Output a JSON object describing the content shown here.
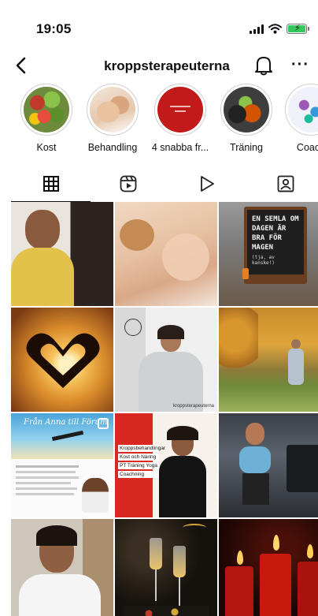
{
  "status": {
    "time": "19:05"
  },
  "header": {
    "username": "kroppsterapeuterna"
  },
  "highlights": [
    {
      "label": "Kost",
      "icon": "vegetables"
    },
    {
      "label": "Behandling",
      "icon": "massage"
    },
    {
      "label": "4 snabba fr...",
      "icon": "red-cover"
    },
    {
      "label": "Träning",
      "icon": "kettlebells"
    },
    {
      "label": "Coach",
      "icon": "coach"
    }
  ],
  "tabs": [
    {
      "name": "grid",
      "icon": "grid-icon",
      "active": true
    },
    {
      "name": "reels",
      "icon": "reels-icon",
      "active": false
    },
    {
      "name": "videos",
      "icon": "play-icon",
      "active": false
    },
    {
      "name": "tagged",
      "icon": "tagged-icon",
      "active": false
    }
  ],
  "posts": {
    "chalkboard_text": "EN SEMLA OM DAGEN ÄR BRA FÖR MAGEN",
    "chalkboard_sub": "(tja, av kanske!)",
    "article_headline": "Från Anna till Förum",
    "article_credit": "kroppsterapeuterna",
    "poster_lines": [
      "Kroppsbehandlingar",
      "Kost och Näring",
      "PT Träning Yoga",
      "Coachning"
    ]
  }
}
